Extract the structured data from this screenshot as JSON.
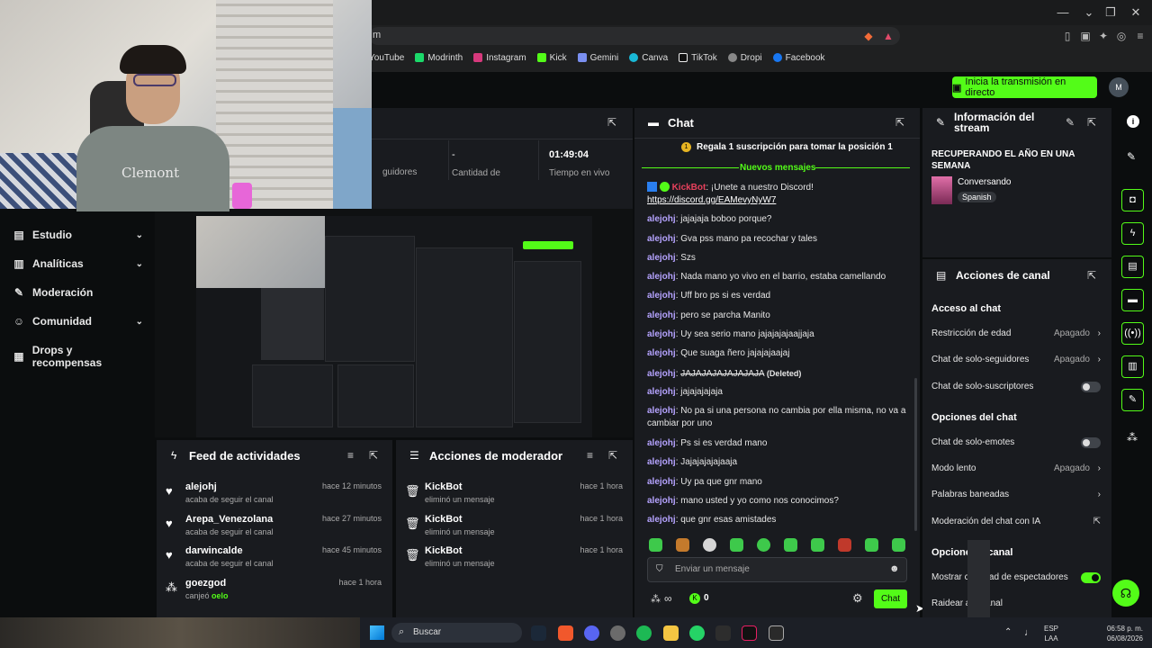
{
  "browser": {
    "url_fragment": "m",
    "bookmarks": [
      "YouTube",
      "Modrinth",
      "Instagram",
      "Kick",
      "Gemini",
      "Canva",
      "TikTok",
      "Dropi",
      "Facebook"
    ]
  },
  "header": {
    "go_live": "Inicia la transmisión en directo",
    "avatar": "M"
  },
  "webcam": {
    "shirt_text": "Clemont"
  },
  "nav": [
    {
      "label": "Estudio",
      "icon": "studio-icon",
      "chevron": true
    },
    {
      "label": "Analíticas",
      "icon": "analytics-icon",
      "chevron": true
    },
    {
      "label": "Moderación",
      "icon": "wrench-icon",
      "chevron": false
    },
    {
      "label": "Comunidad",
      "icon": "community-icon",
      "chevron": true
    },
    {
      "label": "Drops y recompensas",
      "icon": "drops-icon",
      "chevron": false
    }
  ],
  "stats": {
    "followers_label": "guidores",
    "subs_value": "-",
    "subs_label": "Cantidad de",
    "live_value": "01:49:04",
    "live_label": "Tiempo en vivo"
  },
  "feed": {
    "title": "Feed de actividades",
    "items": [
      {
        "name": "alejohj",
        "desc": "acaba de seguir el canal",
        "time": "hace 12 minutos"
      },
      {
        "name": "Arepa_Venezolana",
        "desc": "acaba de seguir el canal",
        "time": "hace 27 minutos"
      },
      {
        "name": "darwincalde",
        "desc": "acaba de seguir el canal",
        "time": "hace 45 minutos"
      },
      {
        "name": "goezgod",
        "desc": "canjeó",
        "extra": "oelo",
        "time": "hace 1 hora"
      }
    ]
  },
  "mod_actions": {
    "title": "Acciones de moderador",
    "items": [
      {
        "name": "KickBot",
        "desc": "eliminó un mensaje",
        "time": "hace 1 hora"
      },
      {
        "name": "KickBot",
        "desc": "eliminó un mensaje",
        "time": "hace 1 hora"
      },
      {
        "name": "KickBot",
        "desc": "eliminó un mensaje",
        "time": "hace 1 hora"
      }
    ]
  },
  "chat": {
    "title": "Chat",
    "gift_banner": "Regala 1 suscripción para tomar la posición 1",
    "new_messages": "Nuevos mensajes",
    "bot_name": "KickBot",
    "bot_msg": "¡Unete a nuestro Discord!",
    "bot_link": "https://discord.gg/EAMevyNyW7",
    "messages": [
      {
        "user": "alejohj",
        "text": "jajajaja boboo porque?"
      },
      {
        "user": "alejohj",
        "text": "Gva pss mano pa recochar y tales"
      },
      {
        "user": "alejohj",
        "text": "Szs"
      },
      {
        "user": "alejohj",
        "text": "Nada mano yo vivo en el barrio, estaba camellando"
      },
      {
        "user": "alejohj",
        "text": "Uff bro ps si es verdad"
      },
      {
        "user": "alejohj",
        "text": "pero se parcha Manito"
      },
      {
        "user": "alejohj",
        "text": "Uy sea serio mano jajajajajaajjaja"
      },
      {
        "user": "alejohj",
        "text": "Que suaga ñero jajajajaajaj"
      },
      {
        "user": "alejohj",
        "text": "JAJAJAJAJAJAJAJA",
        "deleted": "(Deleted)"
      },
      {
        "user": "alejohj",
        "text": "jajajajajaja"
      },
      {
        "user": "alejohj",
        "text": "No pa si una persona no cambia por ella misma, no va a cambiar por uno"
      },
      {
        "user": "alejohj",
        "text": "Ps si es verdad mano"
      },
      {
        "user": "alejohj",
        "text": "Jajajajajajaaja"
      },
      {
        "user": "alejohj",
        "text": "Uy pa que gnr mano"
      },
      {
        "user": "alejohj",
        "text": "mano usted y yo como nos conocimos?"
      },
      {
        "user": "alejohj",
        "text": "que gnr esas amistades"
      }
    ],
    "input_placeholder": "Enviar un mensaje",
    "points": "0",
    "send_label": "Chat"
  },
  "stream_info": {
    "title": "Información del stream",
    "stream_title": "RECUPERANDO EL AÑO EN UNA SEMANA",
    "category": "Conversando",
    "language": "Spanish"
  },
  "channel_actions": {
    "title": "Acciones de canal",
    "section_chat_access": "Acceso al chat",
    "age_restriction": "Restricción de edad",
    "age_value": "Apagado",
    "followers_only": "Chat de solo-seguidores",
    "followers_value": "Apagado",
    "subs_only": "Chat de solo-suscriptores",
    "section_chat_options": "Opciones del chat",
    "emotes_only": "Chat de solo-emotes",
    "slow_mode": "Modo lento",
    "slow_value": "Apagado",
    "banned_words": "Palabras baneadas",
    "ai_moderation": "Moderación del chat con IA",
    "section_channel_options": "Opcione    l canal",
    "show_viewers": "Mostrar c        ad de espectadores",
    "raid": "Raidear a      anal"
  },
  "taskbar": {
    "search": "Buscar",
    "lang": "ESP",
    "lang2": "LAA",
    "time": "06:58 p. m.",
    "date": "06/08/2026"
  }
}
